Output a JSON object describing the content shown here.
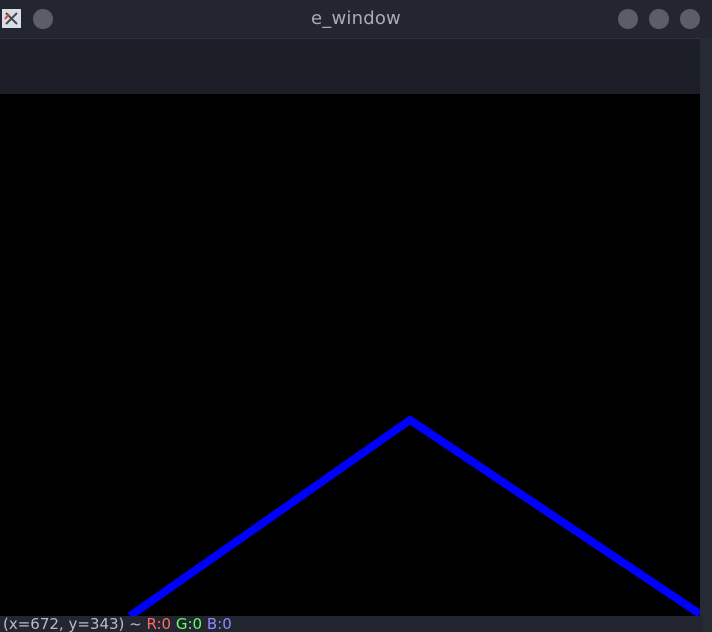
{
  "window": {
    "title": "e_window"
  },
  "status": {
    "coords": "(x=672, y=343) ~",
    "r": "R:0",
    "g": "G:0",
    "b": "B:0"
  },
  "canvas": {
    "line_color": "#0000ff",
    "background": "#000000"
  },
  "colors": {
    "titlebar": "#232630",
    "toolbar": "#1b1e27",
    "status_r": "#ff6b6b",
    "status_g": "#63ff63",
    "status_b": "#8a8aff"
  }
}
